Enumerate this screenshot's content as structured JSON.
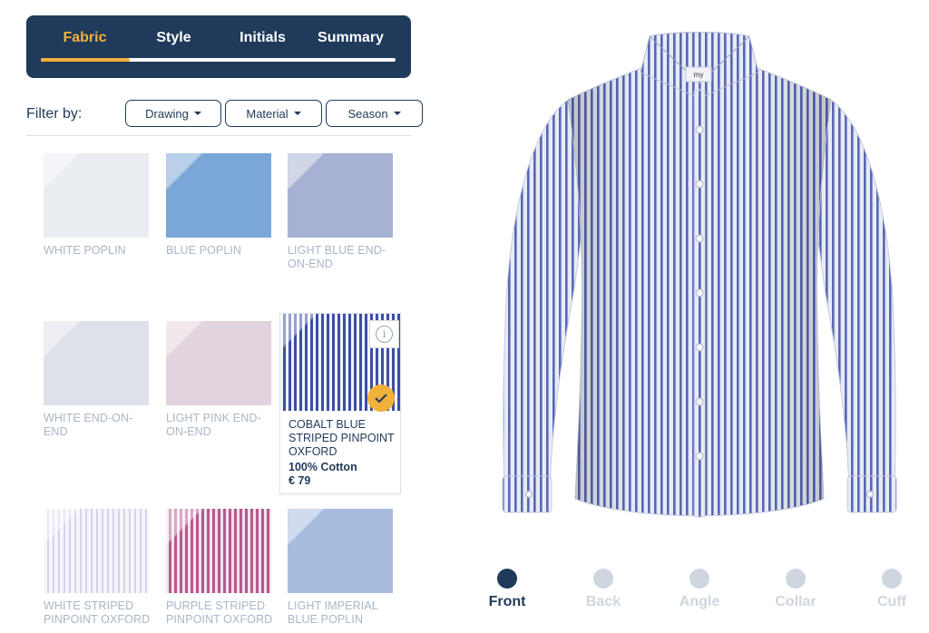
{
  "steps": {
    "items": [
      {
        "label": "Fabric",
        "active": true
      },
      {
        "label": "Style",
        "active": false
      },
      {
        "label": "Initials",
        "active": false
      },
      {
        "label": "Summary",
        "active": false
      }
    ],
    "progress_fraction": 0.25
  },
  "filters": {
    "label": "Filter by:",
    "drawing": "Drawing",
    "material": "Material",
    "season": "Season"
  },
  "fabrics": [
    {
      "name": "WHITE POPLIN",
      "color": "#e9ecf1",
      "pattern": "plain"
    },
    {
      "name": "BLUE POPLIN",
      "color": "#7aa6d8",
      "pattern": "plain"
    },
    {
      "name": "LIGHT BLUE END-ON-END",
      "color": "#a7b1d3",
      "pattern": "plain"
    },
    {
      "name": "WHITE END-ON-END",
      "color": "#dfe1ea",
      "pattern": "plain"
    },
    {
      "name": "LIGHT PINK END-ON-END",
      "color": "#e2d4de",
      "pattern": "plain"
    },
    {
      "name": "WHITE STRIPED PINPOINT OXFORD",
      "color": "#e6e4f2",
      "pattern": "stripe-light"
    },
    {
      "name": "PURPLE STRIPED PINPOINT OXFORD",
      "color": "#b8588f",
      "pattern": "stripe-purple"
    },
    {
      "name": "LIGHT IMPERIAL BLUE POPLIN",
      "color": "#a6bde0",
      "pattern": "plain"
    }
  ],
  "selected_fabric": {
    "name": "COBALT BLUE STRIPED PINPOINT OXFORD",
    "material": "100% Cotton",
    "price": "€ 79",
    "stripe_color": "#3b4fa6"
  },
  "icons": {
    "info": "info-icon",
    "check": "check-icon",
    "caret": "caret-down-icon"
  },
  "shirt": {
    "label_text": "my",
    "body_color": "#e8ebf5",
    "stripe_color": "#5667b4"
  },
  "views": [
    {
      "label": "Front",
      "active": true
    },
    {
      "label": "Back",
      "active": false
    },
    {
      "label": "Angle",
      "active": false
    },
    {
      "label": "Collar",
      "active": false
    },
    {
      "label": "Cuff",
      "active": false
    }
  ],
  "colors": {
    "navy": "#1f3a5a",
    "accent": "#f2b13a",
    "muted": "#cfd6df"
  }
}
